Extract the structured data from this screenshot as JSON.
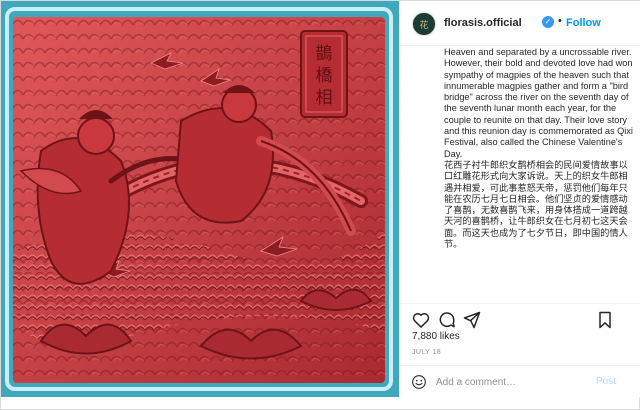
{
  "post": {
    "username": "florasis.official",
    "verified_glyph": "✓",
    "separator": "•",
    "follow_label": "Follow",
    "avatar_text": "花",
    "image_text": "鵲橋相會",
    "caption_en": "Heaven and separated by a uncrossable river. However, their bold and devoted love had won sympathy of magpies of the heaven such that innumerable magpies gather and form a \"bird bridge\" across the river on the seventh day of the seventh lunar month each year, for the couple to reunite on that day. Their love story and this reunion day is commemorated as Qixi Festival, also called the Chinese Valentine's Day.",
    "caption_zh": "花西子衬牛郎织女鹊桥相会的民间爱情故事以口红雕花形式向大家诉说。天上的织女牛郎相遇并相爱，可此事惹怒天帝，惩罚他们每年只能在农历七月七日相会。他们坚贞的爱情感动了喜鹊，无数喜鹊飞来，用身体搭成一道跨越天河的喜鹊桥，让牛郎织女在七月初七这天会面。而这天也成为了七夕节日，即中国的情人节。",
    "likes": "7,880 likes",
    "date": "JULY 18",
    "comment_placeholder": "Add a comment…",
    "post_label": "Post",
    "icons": [
      "heart-icon",
      "comment-icon",
      "share-icon",
      "bookmark-icon",
      "emoji-icon",
      "verified-icon"
    ]
  },
  "colors": {
    "frame": "#3fa8bd",
    "relief": "#c8383c",
    "relief_dark": "#8e1d22",
    "link": "#0095f6",
    "verified": "#3897f0",
    "post_disabled": "#b2dffc"
  }
}
